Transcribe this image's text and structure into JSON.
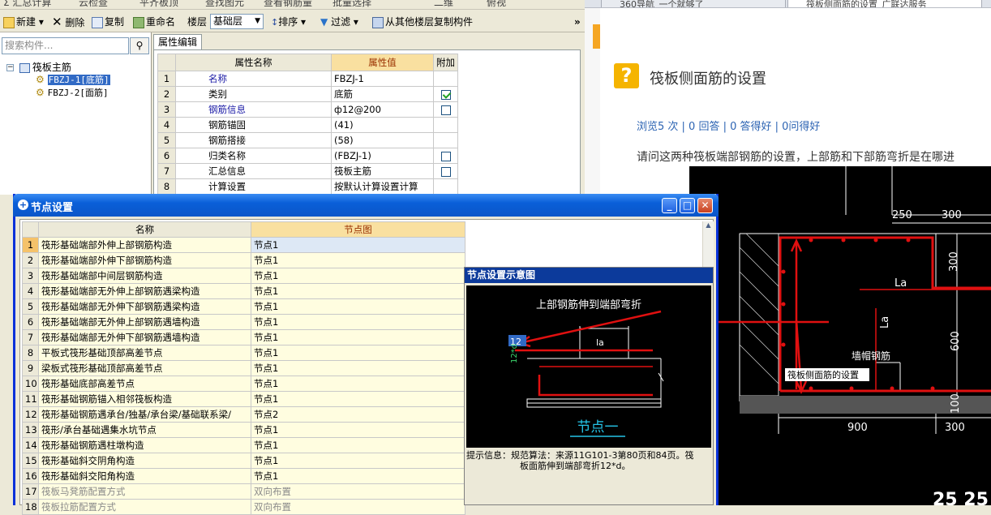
{
  "topstrip": {
    "items": [
      "Σ 汇总计算",
      "云检查",
      "平齐板顶",
      "查找图元",
      "查看钢筋量",
      "批量选择",
      "二维",
      "俯视"
    ]
  },
  "toolbar": {
    "new": "新建",
    "delete": "删除",
    "copy": "复制",
    "rename": "重命名",
    "floor_label": "楼层",
    "floor_value": "基础层",
    "sort": "排序",
    "filter": "过滤",
    "copy_from": "从其他楼层复制构件",
    "more": "»"
  },
  "left": {
    "search_placeholder": "搜索构件...",
    "root": "筏板主筋",
    "items": [
      "FBZJ-1[底筋]",
      "FBZJ-2[面筋]"
    ]
  },
  "props": {
    "tab": "属性编辑",
    "headers": [
      "属性名称",
      "属性值",
      "附加"
    ],
    "rows": [
      {
        "n": "1",
        "name": "名称",
        "value": "FBZJ-1",
        "check": null
      },
      {
        "n": "2",
        "name": "类别",
        "value": "底筋",
        "check": true
      },
      {
        "n": "3",
        "name": "钢筋信息",
        "value": "ф12@200",
        "check": false
      },
      {
        "n": "4",
        "name": "钢筋锚固",
        "value": "(41)",
        "check": null
      },
      {
        "n": "5",
        "name": "钢筋搭接",
        "value": "(58)",
        "check": null
      },
      {
        "n": "6",
        "name": "归类名称",
        "value": "(FBZJ-1)",
        "check": false
      },
      {
        "n": "7",
        "name": "汇总信息",
        "value": "筏板主筋",
        "check": false
      },
      {
        "n": "8",
        "name": "计算设置",
        "value": "按默认计算设置计算",
        "check": null
      }
    ]
  },
  "dialog": {
    "title": "节点设置",
    "headers": [
      "名称",
      "节点图"
    ],
    "rows": [
      {
        "n": "1",
        "name": "筏形基础端部外伸上部钢筋构造",
        "value": "节点1"
      },
      {
        "n": "2",
        "name": "筏形基础端部外伸下部钢筋构造",
        "value": "节点1"
      },
      {
        "n": "3",
        "name": "筏形基础端部中间层钢筋构造",
        "value": "节点1"
      },
      {
        "n": "4",
        "name": "筏形基础端部无外伸上部钢筋遇梁构造",
        "value": "节点1"
      },
      {
        "n": "5",
        "name": "筏形基础端部无外伸下部钢筋遇梁构造",
        "value": "节点1"
      },
      {
        "n": "6",
        "name": "筏形基础端部无外伸上部钢筋遇墙构造",
        "value": "节点1"
      },
      {
        "n": "7",
        "name": "筏形基础端部无外伸下部钢筋遇墙构造",
        "value": "节点1"
      },
      {
        "n": "8",
        "name": "平板式筏形基础顶部高差节点",
        "value": "节点1"
      },
      {
        "n": "9",
        "name": "梁板式筏形基础顶部高差节点",
        "value": "节点1"
      },
      {
        "n": "10",
        "name": "筏形基础底部高差节点",
        "value": "节点1"
      },
      {
        "n": "11",
        "name": "筏形基础钢筋锚入相邻筏板构造",
        "value": "节点1"
      },
      {
        "n": "12",
        "name": "筏形基础钢筋遇承台/独基/承台梁/基础联系梁/",
        "value": "节点2"
      },
      {
        "n": "13",
        "name": "筏形/承台基础遇集水坑节点",
        "value": "节点1"
      },
      {
        "n": "14",
        "name": "筏形基础钢筋遇柱墩构造",
        "value": "节点1"
      },
      {
        "n": "15",
        "name": "筏形基础斜交阴角构造",
        "value": "节点1"
      },
      {
        "n": "16",
        "name": "筏形基础斜交阳角构造",
        "value": "节点1"
      },
      {
        "n": "17",
        "name": "筏板马凳筋配置方式",
        "value": "双向布置"
      },
      {
        "n": "18",
        "name": "筏板拉筋配置方式",
        "value": "双向布置"
      }
    ],
    "schematic": {
      "title": "节点设置示意图",
      "caption": "上部钢筋伸到端部弯折",
      "dim_la": "la",
      "dim_12": "12",
      "dim_12d": "12*d",
      "node_label": "节点一",
      "hint_label": "提示信息：",
      "hint_text_1": "规范算法：来源11G101-3第80页和84页。筏",
      "hint_text_2": "板面筋伸到端部弯折12*d。"
    }
  },
  "browser": {
    "tabs": [
      "360导航_一个就够了",
      "筏板侧面筋的设置_广联达服务"
    ],
    "question_title": "筏板侧面筋的设置",
    "stats": "浏览5 次 | 0 回答 | 0 答得好 | 0问得好",
    "body": "请问这两种筏板端部钢筋的设置，上部筋和下部筋弯折是在哪进",
    "cad": {
      "dim_250": "250",
      "dim_300_top": "300",
      "dim_300_v": "300",
      "dim_La_h": "La",
      "dim_La_v": "La",
      "dim_600": "600",
      "dim_100": "100",
      "dim_900": "900",
      "dim_300_bottom": "300",
      "label_cap": "墙帽钢筋",
      "label_side": "筏板侧面筋的设置",
      "corner": "25 25"
    }
  },
  "colors": {
    "xp_title": "#0b56c9",
    "header_value": "#f9e0a0",
    "rebar_red": "#e01010"
  }
}
